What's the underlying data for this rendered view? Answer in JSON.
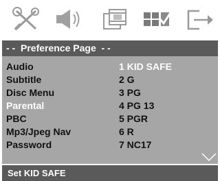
{
  "icons": [
    {
      "name": "general-setup-icon"
    },
    {
      "name": "audio-setup-icon"
    },
    {
      "name": "video-setup-icon"
    },
    {
      "name": "preference-setup-icon"
    },
    {
      "name": "exit-icon"
    }
  ],
  "header": {
    "title": "- -  Preference Page  - -"
  },
  "menu": {
    "rows": [
      {
        "label": "Audio",
        "value": "1 KID SAFE"
      },
      {
        "label": "Subtitle",
        "value": "2 G"
      },
      {
        "label": "Disc Menu",
        "value": "3 PG"
      },
      {
        "label": "Parental",
        "value": "4 PG 13"
      },
      {
        "label": "PBC",
        "value": "5 PGR"
      },
      {
        "label": "Mp3/Jpeg Nav",
        "value": "6 R"
      },
      {
        "label": "Password",
        "value": "7 NC17"
      }
    ],
    "active_label": "Parental",
    "highlighted_value": "1 KID SAFE"
  },
  "status": {
    "text": "Set KID SAFE"
  },
  "colors": {
    "title_bar": "#5a5a5a",
    "menu_bg": "#a6a6a6",
    "active_text": "#ffffff",
    "text": "#111111"
  }
}
